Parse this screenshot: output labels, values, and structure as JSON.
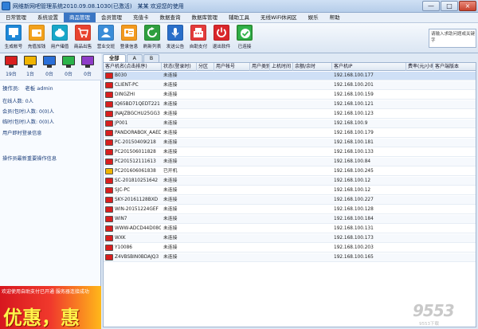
{
  "window": {
    "title": "网维新网吧管理系统2010.09.08.1030(已激活)　某某 欢迎您的使用",
    "buttons": [
      "—",
      "□",
      "×"
    ]
  },
  "menu": [
    {
      "label": "日常管理",
      "active": false
    },
    {
      "label": "系统设置",
      "active": false
    },
    {
      "label": "商品管理",
      "active": true
    },
    {
      "label": "会员管理",
      "active": false
    },
    {
      "label": "充值卡",
      "active": false
    },
    {
      "label": "数据查询",
      "active": false
    },
    {
      "label": "数据库管理",
      "active": false
    },
    {
      "label": "辅助工具",
      "active": false
    },
    {
      "label": "无线WiFi休闲区",
      "active": false
    },
    {
      "label": "娱乐",
      "active": false
    },
    {
      "label": "帮助",
      "active": false
    }
  ],
  "toolbar": [
    {
      "label": "生成帐号",
      "icon": "monitor-icon",
      "color": "#1e88d8"
    },
    {
      "label": "充值加钱",
      "icon": "wallet-icon",
      "color": "#f2a11c"
    },
    {
      "label": "用户储值",
      "icon": "piggy-bank-icon",
      "color": "#18a7c9"
    },
    {
      "label": "商品出售",
      "icon": "shopping-cart-icon",
      "color": "#e8432f"
    },
    {
      "label": "营业交班",
      "icon": "person-icon",
      "color": "#3a8dd8"
    },
    {
      "label": "登录信息",
      "icon": "id-card-icon",
      "color": "#f39a1e"
    },
    {
      "label": "刷新列表",
      "icon": "refresh-icon",
      "color": "#2e9f3e"
    },
    {
      "label": "发送公告",
      "icon": "microphone-icon",
      "color": "#2a6fc9"
    },
    {
      "label": "自助支付",
      "icon": "cash-register-icon",
      "color": "#e33b3b"
    },
    {
      "label": "退出软件",
      "icon": "power-icon",
      "color": "#d9262a"
    },
    {
      "label": "已连接",
      "icon": "connected-icon",
      "color": "#32b34a"
    }
  ],
  "search": {
    "placeholder": "请输入求助问题或关键字"
  },
  "left_panel": {
    "status_counts": [
      {
        "count": "19台",
        "color": "#d81f1f"
      },
      {
        "count": "1台",
        "color": "#f0b400"
      },
      {
        "count": "0台",
        "color": "#2a6fd8"
      },
      {
        "count": "0台",
        "color": "#2bb34a"
      },
      {
        "count": "0台",
        "color": "#8e3cc8"
      }
    ],
    "operator": "操作员:　老板 admin",
    "online": "在线人数: 0人",
    "member": "会员(包时)人数: 0(0)人",
    "temp": "临时(包时)人数: 0(0)人",
    "login_info": "用户即时登录信息",
    "latest_op": "操作员最新重要操作信息",
    "banner_scroll": "欢迎使用自助支付已开通 服务器连接成功",
    "banner_big": "优惠，惠"
  },
  "tabs": [
    "全部",
    "A",
    "B"
  ],
  "columns": [
    "客户机名(点击排序)",
    "状态(登录时)",
    "分区",
    "用户帐号",
    "用户类别",
    "上机时间",
    "余额/余时",
    "客户机IP",
    "费率(元/小时)",
    "客户端版本"
  ],
  "rows": [
    {
      "name": "B030",
      "status": "未连接",
      "ip": "192.168.100.177",
      "pc_color": "#d81f1f",
      "selected": true
    },
    {
      "name": "CLIENT-PC",
      "status": "未连接",
      "ip": "192.168.100.201",
      "pc_color": "#d81f1f",
      "selected": false
    },
    {
      "name": "DINGZHI",
      "status": "未连接",
      "ip": "192.168.100.159",
      "pc_color": "#d81f1f",
      "selected": false
    },
    {
      "name": "IQ65BD71QEDT221",
      "status": "未连接",
      "ip": "192.168.100.121",
      "pc_color": "#d81f1f",
      "selected": false
    },
    {
      "name": "JNAJZBGCHU25GG3",
      "status": "未连接",
      "ip": "192.168.100.123",
      "pc_color": "#d81f1f",
      "selected": false
    },
    {
      "name": "JP001",
      "status": "未连接",
      "ip": "192.168.100.9",
      "pc_color": "#d81f1f",
      "selected": false
    },
    {
      "name": "PANDORABOX_AAED",
      "status": "未连接",
      "ip": "192.168.100.179",
      "pc_color": "#d81f1f",
      "selected": false
    },
    {
      "name": "PC-20150409l218",
      "status": "未连接",
      "ip": "192.168.100.181",
      "pc_color": "#d81f1f",
      "selected": false
    },
    {
      "name": "PC201506011828",
      "status": "未连接",
      "ip": "192.168.100.133",
      "pc_color": "#d81f1f",
      "selected": false
    },
    {
      "name": "PC201512111613",
      "status": "未连接",
      "ip": "192.168.100.84",
      "pc_color": "#d81f1f",
      "selected": false
    },
    {
      "name": "PC201606061838",
      "status": "已开机",
      "ip": "192.168.100.245",
      "pc_color": "#f0b400",
      "selected": false
    },
    {
      "name": "SC-201810251642",
      "status": "未连接",
      "ip": "192.168.100.12",
      "pc_color": "#d81f1f",
      "selected": false
    },
    {
      "name": "SJC-PC",
      "status": "未连接",
      "ip": "192.168.100.12",
      "pc_color": "#d81f1f",
      "selected": false
    },
    {
      "name": "SKY-20161128BXD",
      "status": "未连接",
      "ip": "192.168.100.227",
      "pc_color": "#d81f1f",
      "selected": false
    },
    {
      "name": "WIN-20151224GEF",
      "status": "未连接",
      "ip": "192.168.100.128",
      "pc_color": "#d81f1f",
      "selected": false
    },
    {
      "name": "WIN7",
      "status": "未连接",
      "ip": "192.168.100.184",
      "pc_color": "#d81f1f",
      "selected": false
    },
    {
      "name": "WWW-ADCD44D08C8",
      "status": "未连接",
      "ip": "192.168.100.131",
      "pc_color": "#d81f1f",
      "selected": false
    },
    {
      "name": "WXK",
      "status": "未连接",
      "ip": "192.168.100.173",
      "pc_color": "#d81f1f",
      "selected": false
    },
    {
      "name": "Y10086",
      "status": "未连接",
      "ip": "192.168.100.203",
      "pc_color": "#d81f1f",
      "selected": false
    },
    {
      "name": "Z4VBSBIN0BDAJQ3",
      "status": "未连接",
      "ip": "192.168.100.165",
      "pc_color": "#d81f1f",
      "selected": false
    }
  ],
  "watermark": {
    "big": "9553",
    "sub": "9553下载"
  }
}
